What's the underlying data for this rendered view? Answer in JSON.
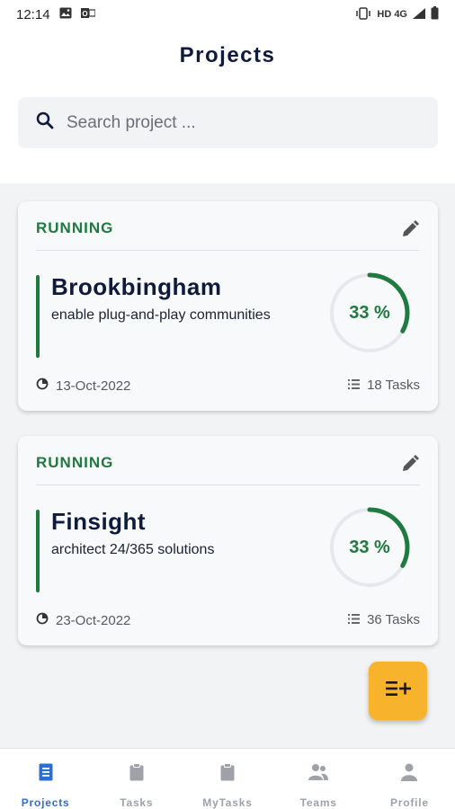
{
  "status_bar": {
    "time": "12:14",
    "network": "HD 4G"
  },
  "header": {
    "title": "Projects"
  },
  "search": {
    "placeholder": "Search project ..."
  },
  "projects": [
    {
      "status": "RUNNING",
      "name": "Brookbingham",
      "description": "enable plug-and-play communities",
      "progress_label": "33 %",
      "progress": 0.33,
      "date": "13-Oct-2022",
      "tasks": "18 Tasks"
    },
    {
      "status": "RUNNING",
      "name": "Finsight",
      "description": "architect 24/365 solutions",
      "progress_label": "33 %",
      "progress": 0.33,
      "date": "23-Oct-2022",
      "tasks": "36 Tasks"
    }
  ],
  "nav": {
    "items": [
      {
        "label": "Projects",
        "icon": "document-icon",
        "active": true
      },
      {
        "label": "Tasks",
        "icon": "clipboard-icon",
        "active": false
      },
      {
        "label": "MyTasks",
        "icon": "clipboard-icon",
        "active": false
      },
      {
        "label": "Teams",
        "icon": "team-icon",
        "active": false
      },
      {
        "label": "Profile",
        "icon": "person-icon",
        "active": false
      }
    ]
  },
  "colors": {
    "accent_green": "#1e7a3e",
    "fab_yellow": "#f7b32b",
    "nav_active": "#2b6fd6",
    "nav_inactive": "#9ea2a8",
    "title_navy": "#0f1b3d"
  }
}
